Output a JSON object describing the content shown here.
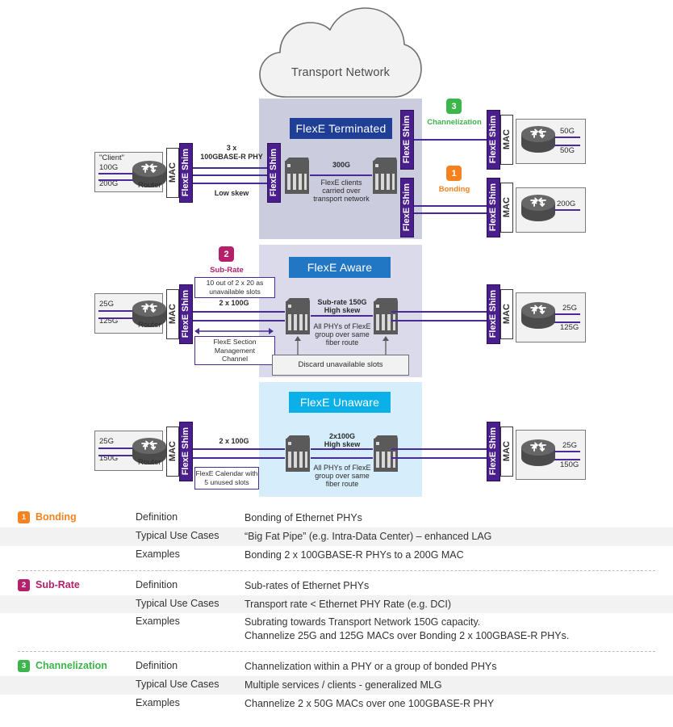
{
  "cloud": {
    "label": "Transport Network"
  },
  "sections": [
    {
      "id": "terminated",
      "title": "FlexE Terminated"
    },
    {
      "id": "aware",
      "title": "FlexE Aware"
    },
    {
      "id": "unaware",
      "title": "FlexE Unaware"
    }
  ],
  "labels": {
    "mac": "MAC",
    "shim": "FlexE Shim",
    "router": "Router",
    "client_quote": "\"Client\""
  },
  "row_terminated": {
    "left_client": {
      "rate_top": "100G",
      "rate_bottom": "200G"
    },
    "link_title_line1": "3 x",
    "link_title_line2": "100GBASE-R PHY",
    "link_sub": "Low skew",
    "transport_rate": "300G",
    "transport_note_l1": "FlexE clients",
    "transport_note_l2": "carried over",
    "transport_note_l3": "transport network",
    "right_top_client": {
      "rate_top": "50G",
      "rate_bottom": "50G"
    },
    "right_bottom_client": {
      "rate": "200G"
    }
  },
  "row_aware": {
    "left_client": {
      "rate_top": "25G",
      "rate_bottom": "125G"
    },
    "slots_box_l1": "10 out of 2 x 20 as",
    "slots_box_l2": "unavailable slots",
    "link_label": "2 x 100G",
    "mgmt_box_l1": "FlexE Section",
    "mgmt_box_l2": "Management",
    "mgmt_box_l3": "Channel",
    "transport_rate_l1": "Sub-rate 150G",
    "transport_rate_l2": "High skew",
    "transport_note_l1": "All PHYs of FlexE",
    "transport_note_l2": "group over same",
    "transport_note_l3": "fiber route",
    "discard_box": "Discard unavailable slots",
    "right_client": {
      "rate_top": "25G",
      "rate_bottom": "125G"
    }
  },
  "row_unaware": {
    "left_client": {
      "rate_top": "25G",
      "rate_bottom": "150G"
    },
    "link_label": "2 x 100G",
    "calendar_box_l1": "FlexE Calendar with",
    "calendar_box_l2": "5 unused slots",
    "transport_rate_l1": "2x100G",
    "transport_rate_l2": "High skew",
    "transport_note_l1": "All PHYs of FlexE",
    "transport_note_l2": "group over same",
    "transport_note_l3": "fiber route",
    "right_client": {
      "rate_top": "25G",
      "rate_bottom": "150G"
    }
  },
  "diagram_badges": [
    {
      "num": "3",
      "caption": "Channelization",
      "color": "#3cb54a"
    },
    {
      "num": "1",
      "caption": "Bonding",
      "color": "#f5821f"
    },
    {
      "num": "2",
      "caption": "Sub-Rate",
      "color": "#b5206b"
    }
  ],
  "legend": {
    "field_labels": {
      "definition": "Definition",
      "use_cases": "Typical Use Cases",
      "examples": "Examples"
    },
    "groups": [
      {
        "num": "1",
        "name": "Bonding",
        "color": "#f5821f",
        "definition": "Bonding of Ethernet PHYs",
        "use_cases": "“Big Fat Pipe” (e.g. Intra-Data Center) – enhanced LAG",
        "examples_l1": "Bonding 2 x 100GBASE-R PHYs to a 200G MAC",
        "examples_l2": ""
      },
      {
        "num": "2",
        "name": "Sub-Rate",
        "color": "#b5206b",
        "definition": "Sub-rates of Ethernet PHYs",
        "use_cases": "Transport rate < Ethernet PHY Rate (e.g. DCI)",
        "examples_l1": "Subrating towards Transport Network 150G capacity.",
        "examples_l2": "Channelize 25G and 125G MACs over Bonding 2 x 100GBASE-R PHYs."
      },
      {
        "num": "3",
        "name": "Channelization",
        "color": "#3cb54a",
        "definition": "Channelization within a PHY or a group of bonded PHYs",
        "use_cases": "Multiple services / clients - generalized MLG",
        "examples_l1": "Channelize 2 x 50G MACs over one 100GBASE-R PHY",
        "examples_l2": ""
      }
    ]
  },
  "colors": {
    "panel_terminated": "#ccccdf",
    "panel_aware": "#dadaeb",
    "panel_unaware": "#d6eefb",
    "title_terminated": "#1f3f96",
    "title_aware": "#2277c4",
    "title_unaware": "#0bb0e8",
    "shim_purple": "#4a1e8c",
    "link_purple": "#4a2a96",
    "node_gray": "#5a5a5a"
  }
}
